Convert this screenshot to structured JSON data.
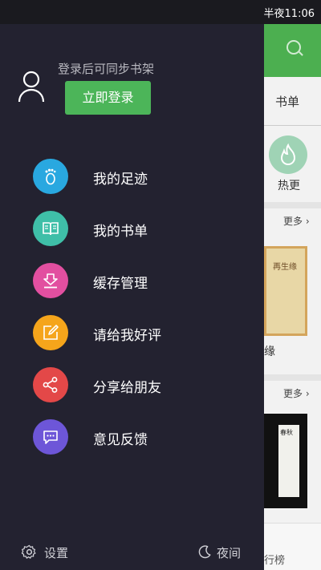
{
  "status_bar": {
    "time": "半夜11:06"
  },
  "background": {
    "tab_booklist": "书单",
    "hot_label": "热更",
    "more_1": "更多",
    "book_title_fragment": "缘",
    "book1_cover_text": "再生缘",
    "more_2": "更多",
    "book2_cover_text": "春秋",
    "rank_label": "行榜"
  },
  "drawer": {
    "login_hint": "登录后可同步书架",
    "login_button": "立即登录",
    "menu": [
      {
        "label": "我的足迹",
        "icon": "footprint-icon",
        "color": "#29a8e0"
      },
      {
        "label": "我的书单",
        "icon": "book-icon",
        "color": "#3fbfa8"
      },
      {
        "label": "缓存管理",
        "icon": "download-icon",
        "color": "#e24fa0"
      },
      {
        "label": "请给我好评",
        "icon": "edit-icon",
        "color": "#f5a51b"
      },
      {
        "label": "分享给朋友",
        "icon": "share-icon",
        "color": "#e34848"
      },
      {
        "label": "意见反馈",
        "icon": "feedback-icon",
        "color": "#6d56d8"
      }
    ],
    "footer": {
      "settings_label": "设置",
      "night_label": "夜间"
    }
  },
  "colors": {
    "accent_green": "#4cb559",
    "drawer_bg": "#232230"
  }
}
